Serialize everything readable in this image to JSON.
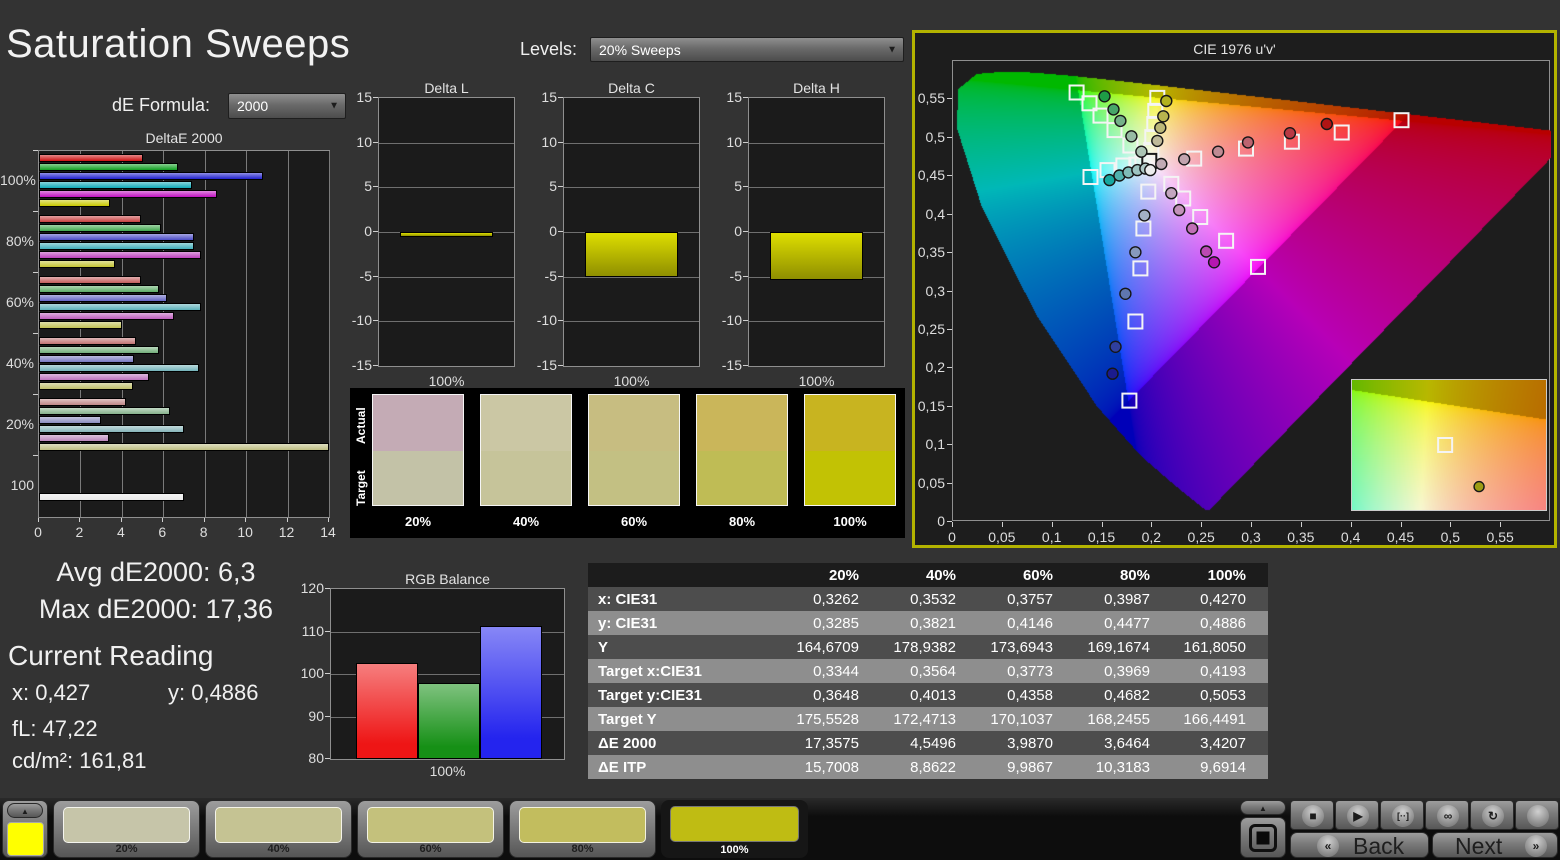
{
  "header": {
    "title": "Saturation Sweeps",
    "de_formula_label": "dE Formula:",
    "de_formula_value": "2000",
    "levels_label": "Levels:",
    "levels_value": "20% Sweeps"
  },
  "stats": {
    "avg": "Avg dE2000: 6,3",
    "max": "Max dE2000: 17,36",
    "current_reading": "Current Reading",
    "x": "x: 0,427",
    "y": "y: 0,4886",
    "fl": "fL: 47,22",
    "cdm2": "cd/m²: 161,81"
  },
  "chart_data": [
    {
      "id": "deltae2000",
      "type": "bar",
      "orientation": "horizontal",
      "title": "DeltaE 2000",
      "categories": [
        "100%",
        "80%",
        "60%",
        "40%",
        "20%",
        "100"
      ],
      "xlim": [
        0,
        14
      ],
      "xticks": [
        0,
        2,
        4,
        6,
        8,
        10,
        12,
        14
      ],
      "series": [
        {
          "name": "red",
          "color": "#cc1111",
          "values": [
            5.0,
            4.9,
            4.9,
            4.7,
            4.2,
            null
          ]
        },
        {
          "name": "green",
          "color": "#11a022",
          "values": [
            6.7,
            5.9,
            5.8,
            5.8,
            6.3,
            null
          ]
        },
        {
          "name": "blue",
          "color": "#2020cc",
          "values": [
            10.8,
            7.5,
            6.2,
            4.6,
            3.0,
            null
          ]
        },
        {
          "name": "cyan",
          "color": "#10aab8",
          "values": [
            7.4,
            7.5,
            7.8,
            7.7,
            7.0,
            null
          ]
        },
        {
          "name": "magenta",
          "color": "#c011c0",
          "values": [
            8.6,
            7.8,
            6.5,
            5.3,
            3.4,
            null
          ]
        },
        {
          "name": "yellow",
          "color": "#c8c800",
          "values": [
            3.42,
            3.65,
            3.99,
            4.55,
            17.36,
            null
          ]
        },
        {
          "name": "white",
          "color": "#e8e8e8",
          "values": [
            null,
            null,
            null,
            null,
            null,
            7.0
          ]
        }
      ],
      "group_saturation": [
        1,
        0.72,
        0.55,
        0.42,
        0.3,
        1
      ]
    },
    {
      "id": "deltaL",
      "type": "bar",
      "title": "Delta L",
      "categories": [
        "100%"
      ],
      "values": [
        -0.5
      ],
      "ylim": [
        -15,
        15
      ],
      "yticks": [
        "15",
        "10",
        "5",
        "0",
        "-5",
        "-10",
        "-15"
      ],
      "bar_color": "#c8c800"
    },
    {
      "id": "deltaC",
      "type": "bar",
      "title": "Delta C",
      "categories": [
        "100%"
      ],
      "values": [
        -5.0
      ],
      "ylim": [
        -15,
        15
      ],
      "yticks": [
        "15",
        "10",
        "5",
        "0",
        "-5",
        "-10",
        "-15"
      ],
      "bar_color": "#c8c800"
    },
    {
      "id": "deltaH",
      "type": "bar",
      "title": "Delta H",
      "categories": [
        "100%"
      ],
      "values": [
        -5.4
      ],
      "ylim": [
        -15,
        15
      ],
      "yticks": [
        "15",
        "10",
        "5",
        "0",
        "-5",
        "-10",
        "-15"
      ],
      "bar_color": "#c8c800"
    },
    {
      "id": "rgb_balance",
      "type": "bar",
      "title": "RGB Balance",
      "categories": [
        "100%"
      ],
      "ylim": [
        80,
        120
      ],
      "yticks": [
        "120",
        "110",
        "100",
        "90",
        "80"
      ],
      "series": [
        {
          "name": "red",
          "color": "#ee1515",
          "value": 102.7
        },
        {
          "name": "green",
          "color": "#169016",
          "value": 98.0
        },
        {
          "name": "blue",
          "color": "#2424ee",
          "value": 111.2
        }
      ]
    },
    {
      "id": "cie",
      "type": "scatter",
      "title": "CIE 1976 u'v'",
      "xlim": [
        0,
        0.6
      ],
      "ylim": [
        0,
        0.6
      ],
      "xtick_values": [
        0,
        0.05,
        0.1,
        0.15,
        0.2,
        0.25,
        0.3,
        0.35,
        0.4,
        0.45,
        0.5,
        0.55
      ],
      "xtick_labels": [
        "0",
        "0,05",
        "0,1",
        "0,15",
        "0,2",
        "0,25",
        "0,3",
        "0,35",
        "0,4",
        "0,45",
        "0,5",
        "0,55"
      ],
      "ytick_values": [
        0,
        0.05,
        0.1,
        0.15,
        0.2,
        0.25,
        0.3,
        0.35,
        0.4,
        0.45,
        0.5,
        0.55
      ],
      "ytick_labels": [
        "0",
        "0,05",
        "0,1",
        "0,15",
        "0,2",
        "0,25",
        "0,3",
        "0,35",
        "0,4",
        "0,45",
        "0,5",
        "0,55"
      ],
      "sweeps": [
        {
          "name": "red",
          "targets": [
            [
              0.45,
              0.523
            ],
            [
              0.39,
              0.507
            ],
            [
              0.34,
              0.495
            ],
            [
              0.294,
              0.486
            ],
            [
              0.242,
              0.473
            ]
          ],
          "measured": [
            [
              0.375,
              0.518
            ],
            [
              0.338,
              0.506
            ],
            [
              0.296,
              0.494
            ],
            [
              0.266,
              0.482
            ],
            [
              0.232,
              0.472
            ]
          ],
          "fills": [
            "#b11414",
            "#b83a44",
            "#bd6470",
            "#c08b94",
            "#c2a4ae"
          ]
        },
        {
          "name": "green",
          "targets": [
            [
              0.124,
              0.559
            ],
            [
              0.137,
              0.545
            ],
            [
              0.148,
              0.529
            ],
            [
              0.162,
              0.51
            ],
            [
              0.178,
              0.49
            ]
          ],
          "measured": [
            [
              0.152,
              0.554
            ],
            [
              0.161,
              0.537
            ],
            [
              0.168,
              0.522
            ],
            [
              0.179,
              0.502
            ],
            [
              0.189,
              0.482
            ]
          ],
          "fills": [
            "#1e9c46",
            "#47a669",
            "#74b189",
            "#97bba4",
            "#abc4b4"
          ]
        },
        {
          "name": "blue",
          "targets": [
            [
              0.177,
              0.158
            ],
            [
              0.183,
              0.261
            ],
            [
              0.188,
              0.33
            ],
            [
              0.191,
              0.382
            ],
            [
              0.196,
              0.43
            ]
          ],
          "measured": [
            [
              0.16,
              0.193
            ],
            [
              0.163,
              0.228
            ],
            [
              0.173,
              0.297
            ],
            [
              0.183,
              0.351
            ],
            [
              0.192,
              0.399
            ]
          ],
          "fills": [
            "#1b1b8e",
            "#2f3f9e",
            "#5f76b0",
            "#8799bd",
            "#a3b0c6"
          ]
        },
        {
          "name": "cyan",
          "targets": [
            [
              0.138,
              0.449
            ],
            [
              0.155,
              0.458
            ],
            [
              0.171,
              0.464
            ],
            [
              0.184,
              0.465
            ],
            [
              0.19,
              0.467
            ]
          ],
          "measured": [
            [
              0.157,
              0.445
            ],
            [
              0.167,
              0.451
            ],
            [
              0.176,
              0.455
            ],
            [
              0.185,
              0.458
            ],
            [
              0.193,
              0.46
            ]
          ],
          "fills": [
            "#17a8a0",
            "#4fb1ad",
            "#7fbcb8",
            "#9dc4c1",
            "#aec9c6"
          ]
        },
        {
          "name": "magenta",
          "targets": [
            [
              0.306,
              0.332
            ],
            [
              0.274,
              0.366
            ],
            [
              0.248,
              0.397
            ],
            [
              0.231,
              0.421
            ],
            [
              0.219,
              0.44
            ]
          ],
          "measured": [
            [
              0.262,
              0.338
            ],
            [
              0.254,
              0.352
            ],
            [
              0.24,
              0.382
            ],
            [
              0.227,
              0.406
            ],
            [
              0.219,
              0.428
            ]
          ],
          "fills": [
            "#b516b0",
            "#bb49b2",
            "#c06fb5",
            "#c392ba",
            "#c3a6bf"
          ]
        },
        {
          "name": "yellow",
          "targets": [
            [
              0.205,
              0.552
            ],
            [
              0.203,
              0.535
            ],
            [
              0.202,
              0.518
            ],
            [
              0.2,
              0.501
            ],
            [
              0.199,
              0.484
            ]
          ],
          "measured": [
            [
              0.214,
              0.548
            ],
            [
              0.211,
              0.528
            ],
            [
              0.208,
              0.513
            ],
            [
              0.205,
              0.496
            ],
            [
              0.209,
              0.466
            ]
          ],
          "fills": [
            "#b2b21e",
            "#b8b44e",
            "#bcb878",
            "#bfba9a",
            "#c2abb5"
          ]
        },
        {
          "name": "white",
          "dark_square": true,
          "targets": [
            [
              0.197,
              0.47
            ]
          ],
          "measured": [
            [
              0.198,
              0.458
            ]
          ],
          "fills": [
            "#ececec"
          ]
        }
      ],
      "inset": {
        "region_u": [
          0.15,
          0.29
        ],
        "region_v": [
          0.49,
          0.565
        ],
        "square_rel": [
          0.48,
          0.5
        ],
        "circle_rel": [
          0.655,
          0.82
        ],
        "circle_fill": "#9c9c14"
      }
    }
  ],
  "swatch_panel": {
    "row_labels": [
      "Actual",
      "Target"
    ],
    "columns": [
      {
        "label": "20%",
        "actual": "#c4abb5",
        "target": "#c3c2a7"
      },
      {
        "label": "40%",
        "actual": "#cbc7a4",
        "target": "#c6c49a"
      },
      {
        "label": "60%",
        "actual": "#c7bd81",
        "target": "#c3c083"
      },
      {
        "label": "80%",
        "actual": "#cab65a",
        "target": "#bfbc55"
      },
      {
        "label": "100%",
        "actual": "#c8b420",
        "target": "#c2c204"
      }
    ]
  },
  "table": {
    "col_headers": [
      "20%",
      "40%",
      "60%",
      "80%",
      "100%"
    ],
    "rows": [
      {
        "label": "x: CIE31",
        "values": [
          "0,3262",
          "0,3532",
          "0,3757",
          "0,3987",
          "0,4270"
        ]
      },
      {
        "label": "y: CIE31",
        "values": [
          "0,3285",
          "0,3821",
          "0,4146",
          "0,4477",
          "0,4886"
        ]
      },
      {
        "label": "Y",
        "values": [
          "164,6709",
          "178,9382",
          "173,6943",
          "169,1674",
          "161,8050"
        ]
      },
      {
        "label": "Target x:CIE31",
        "values": [
          "0,3344",
          "0,3564",
          "0,3773",
          "0,3969",
          "0,4193"
        ]
      },
      {
        "label": "Target y:CIE31",
        "values": [
          "0,3648",
          "0,4013",
          "0,4358",
          "0,4682",
          "0,5053"
        ]
      },
      {
        "label": "Target Y",
        "values": [
          "175,5528",
          "172,4713",
          "170,1037",
          "168,2455",
          "166,4491"
        ]
      },
      {
        "label": "ΔE 2000",
        "values": [
          "17,3575",
          "4,5496",
          "3,9870",
          "3,6464",
          "3,4207"
        ]
      },
      {
        "label": "ΔE ITP",
        "values": [
          "15,7008",
          "8,8622",
          "9,9867",
          "10,3183",
          "9,6914"
        ]
      }
    ]
  },
  "bottom_bar": {
    "current_color": "#ffff00",
    "swatches": [
      {
        "label": "20%",
        "color": "#c6c5a9",
        "selected": false
      },
      {
        "label": "40%",
        "color": "#c5c393",
        "selected": false
      },
      {
        "label": "60%",
        "color": "#c4c17c",
        "selected": false
      },
      {
        "label": "80%",
        "color": "#c2bd5e",
        "selected": false
      },
      {
        "label": "100%",
        "color": "#bfbc13",
        "selected": true
      }
    ],
    "nav": {
      "back": "Back",
      "next": "Next"
    },
    "transport_icons": [
      {
        "name": "stop",
        "glyph": "■"
      },
      {
        "name": "play",
        "glyph": "▶"
      },
      {
        "name": "meter",
        "glyph": "[··]"
      },
      {
        "name": "loop",
        "glyph": "∞"
      },
      {
        "name": "refresh",
        "glyph": "↻"
      },
      {
        "name": "extra",
        "glyph": ""
      }
    ]
  },
  "colors": {
    "page_bg": "#333333",
    "chart_bg": "#1b1b1b",
    "panel_border": "#8f8f8f",
    "cie_border": "#b3b300",
    "text": "#e8e8e8",
    "table_row_dark": "#4d4d4d",
    "table_row_light": "#8e8e8e",
    "table_header_bg": "#1c1c1c"
  }
}
